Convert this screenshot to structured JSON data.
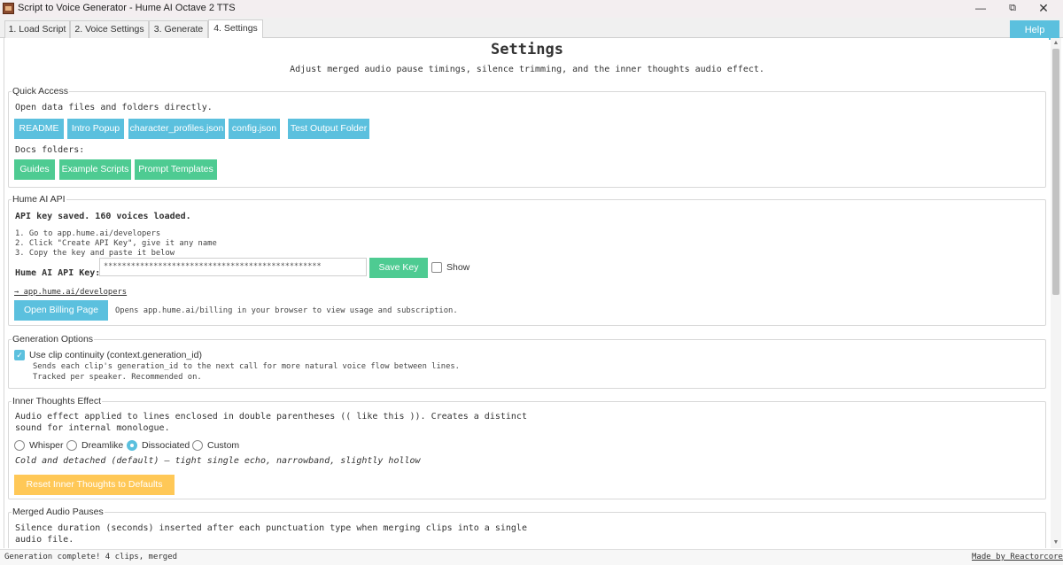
{
  "window": {
    "title": "Script to Voice Generator - Hume AI Octave 2 TTS",
    "minimize": "—",
    "maximize": "⧉",
    "close": "✕"
  },
  "tabs": [
    {
      "label": "1. Load Script",
      "active": false
    },
    {
      "label": "2. Voice Settings",
      "active": false
    },
    {
      "label": "3. Generate",
      "active": false
    },
    {
      "label": "4. Settings",
      "active": true
    }
  ],
  "help_label": "Help",
  "header": {
    "title": "Settings",
    "subtitle": "Adjust merged audio pause timings, silence trimming, and the inner thoughts audio effect."
  },
  "quick_access": {
    "legend": "Quick Access",
    "intro": "Open data files and folders directly.",
    "buttons": [
      "README",
      "Intro Popup",
      "character_profiles.json",
      "config.json",
      "Test Output Folder"
    ],
    "docs_label": "Docs folders:",
    "docs_buttons": [
      "Guides",
      "Example Scripts",
      "Prompt Templates"
    ]
  },
  "hume_api": {
    "legend": "Hume AI API",
    "status": "API key saved. 160 voices loaded.",
    "steps": [
      "1. Go to app.hume.ai/developers",
      "2. Click \"Create API Key\", give it any name",
      "3. Copy the key and paste it below"
    ],
    "key_label": "Hume AI API Key:",
    "key_value": "************************************************",
    "save_label": "Save Key",
    "show_label": "Show",
    "show_checked": false,
    "dev_link": "→ app.hume.ai/developers",
    "billing_button": "Open Billing Page",
    "billing_note": "Opens app.hume.ai/billing in your browser to view usage and subscription."
  },
  "generation_options": {
    "legend": "Generation Options",
    "continuity_label": "Use clip continuity (context.generation_id)",
    "continuity_checked": true,
    "description": [
      "Sends each clip's generation_id to the next call for more natural voice flow between lines.",
      "Tracked per speaker. Recommended on."
    ]
  },
  "inner_thoughts": {
    "legend": "Inner Thoughts Effect",
    "description": [
      "Audio effect applied to lines enclosed in double parentheses (( like this )). Creates a distinct",
      "sound for internal monologue."
    ],
    "options": [
      {
        "label": "Whisper",
        "selected": false
      },
      {
        "label": "Dreamlike",
        "selected": false
      },
      {
        "label": "Dissociated",
        "selected": true
      },
      {
        "label": "Custom",
        "selected": false
      }
    ],
    "selected_description": "Cold and detached (default) — tight single echo, narrowband, slightly hollow",
    "reset_button": "Reset Inner Thoughts to Defaults"
  },
  "merged_pauses": {
    "legend": "Merged Audio Pauses",
    "description": [
      "Silence duration (seconds) inserted after each punctuation type when merging clips into a single",
      "audio file."
    ]
  },
  "status_bar": {
    "message": "Generation complete! 4 clips, merged",
    "credit": "Made by Reactorcore"
  },
  "colors": {
    "info": "#5bc0de",
    "success": "#4ecb92",
    "warning": "#ffc857"
  }
}
